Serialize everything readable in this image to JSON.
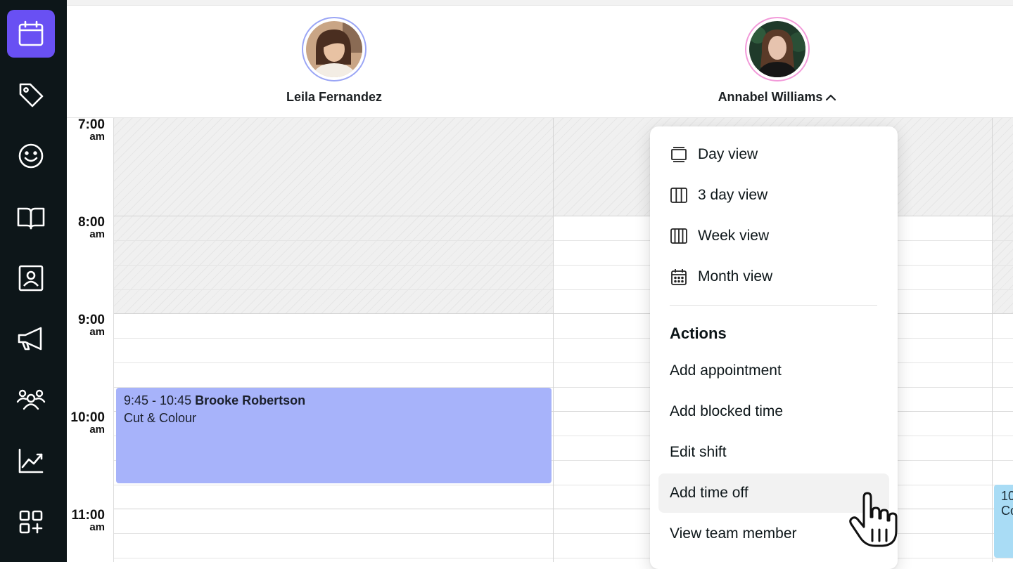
{
  "sidebar": {
    "items": [
      {
        "icon": "calendar-icon",
        "active": true
      },
      {
        "icon": "tag-icon",
        "active": false
      },
      {
        "icon": "smiley-icon",
        "active": false
      },
      {
        "icon": "book-icon",
        "active": false
      },
      {
        "icon": "contact-card-icon",
        "active": false
      },
      {
        "icon": "megaphone-icon",
        "active": false
      },
      {
        "icon": "team-icon",
        "active": false
      },
      {
        "icon": "chart-icon",
        "active": false
      },
      {
        "icon": "add-apps-icon",
        "active": false
      }
    ],
    "active_color": "#6950f3",
    "background": "#0d1619"
  },
  "team": [
    {
      "name": "Leila Fernandez",
      "ring_color": "#9aa5f5"
    },
    {
      "name": "Annabel Williams",
      "ring_color": "#f29ad9",
      "menu_open": true
    }
  ],
  "times": [
    {
      "time": "7:00",
      "period": "am"
    },
    {
      "time": "8:00",
      "period": "am"
    },
    {
      "time": "9:00",
      "period": "am"
    },
    {
      "time": "10:00",
      "period": "am"
    },
    {
      "time": "11:00",
      "period": "am"
    }
  ],
  "appointment": {
    "range": "9:45 - 10:45",
    "client": "Brooke Robertson",
    "service": "Cut & Colour",
    "color": "#a7b3fa"
  },
  "appointment_partial": {
    "text_line1": "10",
    "text_line2": "Co",
    "color": "#a9dcf5"
  },
  "menu": {
    "view_items": [
      {
        "label": "Day view",
        "icon": "day-view-icon"
      },
      {
        "label": "3 day view",
        "icon": "three-day-view-icon"
      },
      {
        "label": "Week view",
        "icon": "week-view-icon"
      },
      {
        "label": "Month view",
        "icon": "month-view-icon"
      }
    ],
    "actions_heading": "Actions",
    "action_items": [
      {
        "label": "Add appointment"
      },
      {
        "label": "Add blocked time"
      },
      {
        "label": "Edit shift"
      },
      {
        "label": "Add time off",
        "hovered": true
      },
      {
        "label": "View team member"
      }
    ]
  }
}
